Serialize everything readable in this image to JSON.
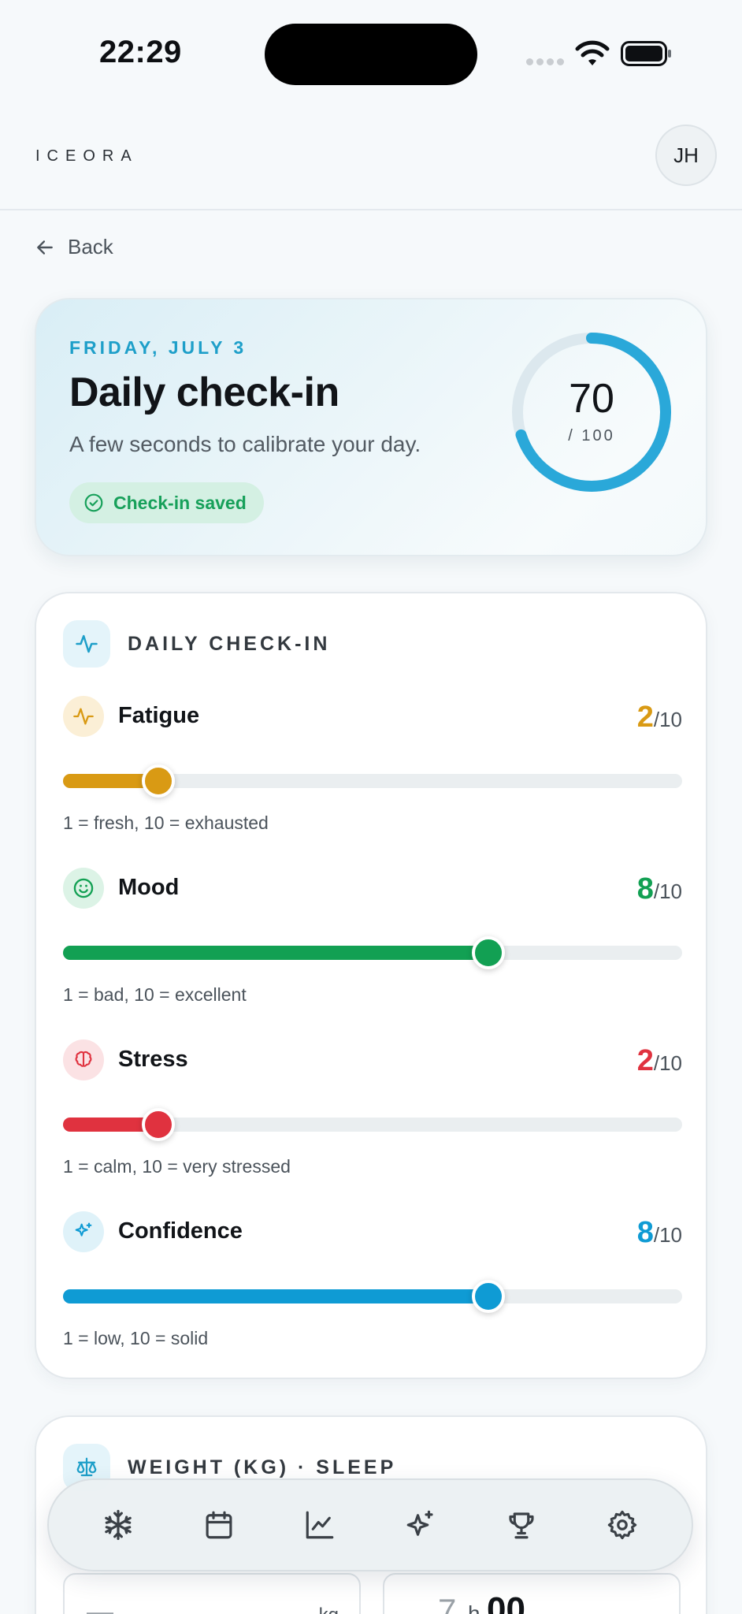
{
  "status_bar": {
    "time": "22:29"
  },
  "header": {
    "logo": "ICEORA",
    "avatar_initials": "JH"
  },
  "nav": {
    "back_label": "Back"
  },
  "hero": {
    "date": "FRIDAY, JULY 3",
    "title": "Daily check-in",
    "subtitle": "A few seconds to calibrate your day.",
    "saved_label": "Check-in saved",
    "score": {
      "value": "70",
      "denominator": "/ 100",
      "fraction": 0.7
    },
    "accent_color": "#1e9fc9"
  },
  "checkin": {
    "title": "DAILY CHECK-IN",
    "metrics": [
      {
        "name": "Fatigue",
        "value": "2",
        "max": "/10",
        "hint": "1 = fresh, 10 = exhausted",
        "level": 2,
        "color": "#d99a14",
        "icon": "activity-icon",
        "icon_bg": "#fbefd6"
      },
      {
        "name": "Mood",
        "value": "8",
        "max": "/10",
        "hint": "1 = bad, 10 = excellent",
        "level": 8,
        "color": "#12a053",
        "icon": "smile-icon",
        "icon_bg": "#dcf3e6"
      },
      {
        "name": "Stress",
        "value": "2",
        "max": "/10",
        "hint": "1 = calm, 10 = very stressed",
        "level": 2,
        "color": "#e0323f",
        "icon": "brain-icon",
        "icon_bg": "#fbe2e4"
      },
      {
        "name": "Confidence",
        "value": "8",
        "max": "/10",
        "hint": "1 = low, 10 = solid",
        "level": 8,
        "color": "#0f9bd4",
        "icon": "sparkles-icon",
        "icon_bg": "#dff2f9"
      }
    ]
  },
  "weight_sleep": {
    "title": "WEIGHT (KG) · SLEEP",
    "weight_value": "—",
    "weight_unit": "kg",
    "sleep_hours": "7",
    "sleep_hours_unit": "h",
    "sleep_minutes": "00"
  },
  "bottom_nav": {
    "items": [
      "snowflake-icon",
      "calendar-icon",
      "chart-icon",
      "sparkles-icon",
      "trophy-icon",
      "settings-icon"
    ]
  }
}
